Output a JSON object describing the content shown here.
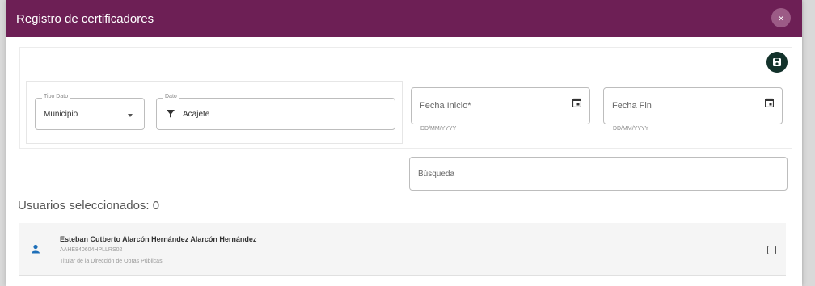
{
  "dialog": {
    "title": "Registro de certificadores",
    "close_label": "×"
  },
  "filters": {
    "tipo_dato": {
      "legend": "Tipo Dato",
      "value": "Municipio"
    },
    "dato": {
      "legend": "Dato",
      "value": "Acajete"
    },
    "fecha_inicio": {
      "placeholder": "Fecha Inicio*",
      "helper": "DD/MM/YYYY"
    },
    "fecha_fin": {
      "placeholder": "Fecha Fin",
      "helper": "DD/MM/YYYY"
    },
    "busqueda": {
      "placeholder": "Búsqueda"
    }
  },
  "selection": {
    "label": "Usuarios seleccionados: 0"
  },
  "users": [
    {
      "name": "Esteban Cutberto Alarcón Hernández Alarcón Hernández",
      "id": "AAHE840604HPLLRS02",
      "role": "Titular de la Dirección de Obras Públicas"
    }
  ],
  "colors": {
    "header_bg": "#6d1f55",
    "save_bg": "#13322b"
  },
  "icons": {
    "close": "close-icon",
    "save": "save-icon",
    "filter": "filter-icon",
    "calendar": "calendar-icon",
    "user": "person-icon"
  }
}
